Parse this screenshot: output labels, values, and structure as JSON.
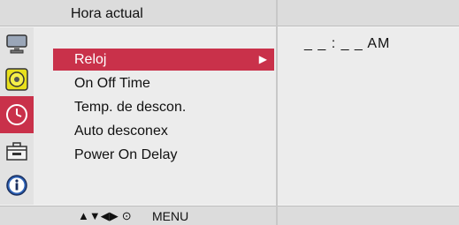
{
  "header": {
    "title": "Hora actual"
  },
  "sidebar": {
    "icons": [
      {
        "name": "monitor-icon"
      },
      {
        "name": "audio-icon"
      },
      {
        "name": "clock-icon",
        "active": true
      },
      {
        "name": "toolbox-icon"
      },
      {
        "name": "info-icon"
      }
    ]
  },
  "menu": {
    "items": [
      {
        "label": "Reloj",
        "selected": true
      },
      {
        "label": "On Off Time"
      },
      {
        "label": "Temp. de descon."
      },
      {
        "label": "Auto desconex"
      },
      {
        "label": "Power On Delay"
      }
    ],
    "submenu_arrow": "▶"
  },
  "value": {
    "time": "_ _ : _ _  AM"
  },
  "footer": {
    "nav_glyphs": "▲▼◀▶",
    "ok_glyph": "⊙",
    "menu_label": "MENU"
  },
  "colors": {
    "accent": "#c9314a",
    "panel": "#ececec",
    "bar": "#dcdcdc"
  }
}
